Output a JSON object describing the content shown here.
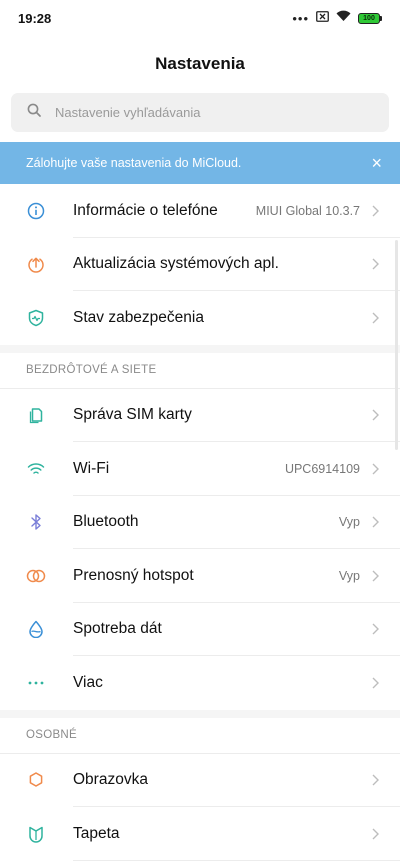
{
  "status_bar": {
    "time": "19:28",
    "more": "•••",
    "battery_level": "100",
    "battery_color": "#2fc936"
  },
  "page": {
    "title": "Nastavenia"
  },
  "search": {
    "placeholder": "Nastavenie vyhľadávania"
  },
  "banner": {
    "text": "Zálohujte vaše nastavenia do MiCloud.",
    "close": "×",
    "color": "#73b6e6"
  },
  "top_items": [
    {
      "label": "Informácie o telefóne",
      "value": "MIUI Global 10.3.7",
      "icon": "info-icon"
    },
    {
      "label": "Aktualizácia systémových apl.",
      "value": "",
      "icon": "update-arrow-icon"
    },
    {
      "label": "Stav zabezpečenia",
      "value": "",
      "icon": "shield-icon"
    }
  ],
  "wireless": {
    "header": "BEZDRÔTOVÉ A SIETE",
    "items": [
      {
        "label": "Správa SIM karty",
        "value": "",
        "icon": "sim-card-icon"
      },
      {
        "label": "Wi-Fi",
        "value": "UPC6914109",
        "icon": "wifi-icon"
      },
      {
        "label": "Bluetooth",
        "value": "Vyp",
        "icon": "bluetooth-icon"
      },
      {
        "label": "Prenosný hotspot",
        "value": "Vyp",
        "icon": "hotspot-icon"
      },
      {
        "label": "Spotreba dát",
        "value": "",
        "icon": "data-drop-icon"
      },
      {
        "label": "Viac",
        "value": "",
        "icon": "more-dots-icon"
      }
    ]
  },
  "personal": {
    "header": "OSOBNÉ",
    "items": [
      {
        "label": "Obrazovka",
        "value": "",
        "icon": "display-icon"
      },
      {
        "label": "Tapeta",
        "value": "",
        "icon": "wallpaper-icon"
      }
    ]
  }
}
